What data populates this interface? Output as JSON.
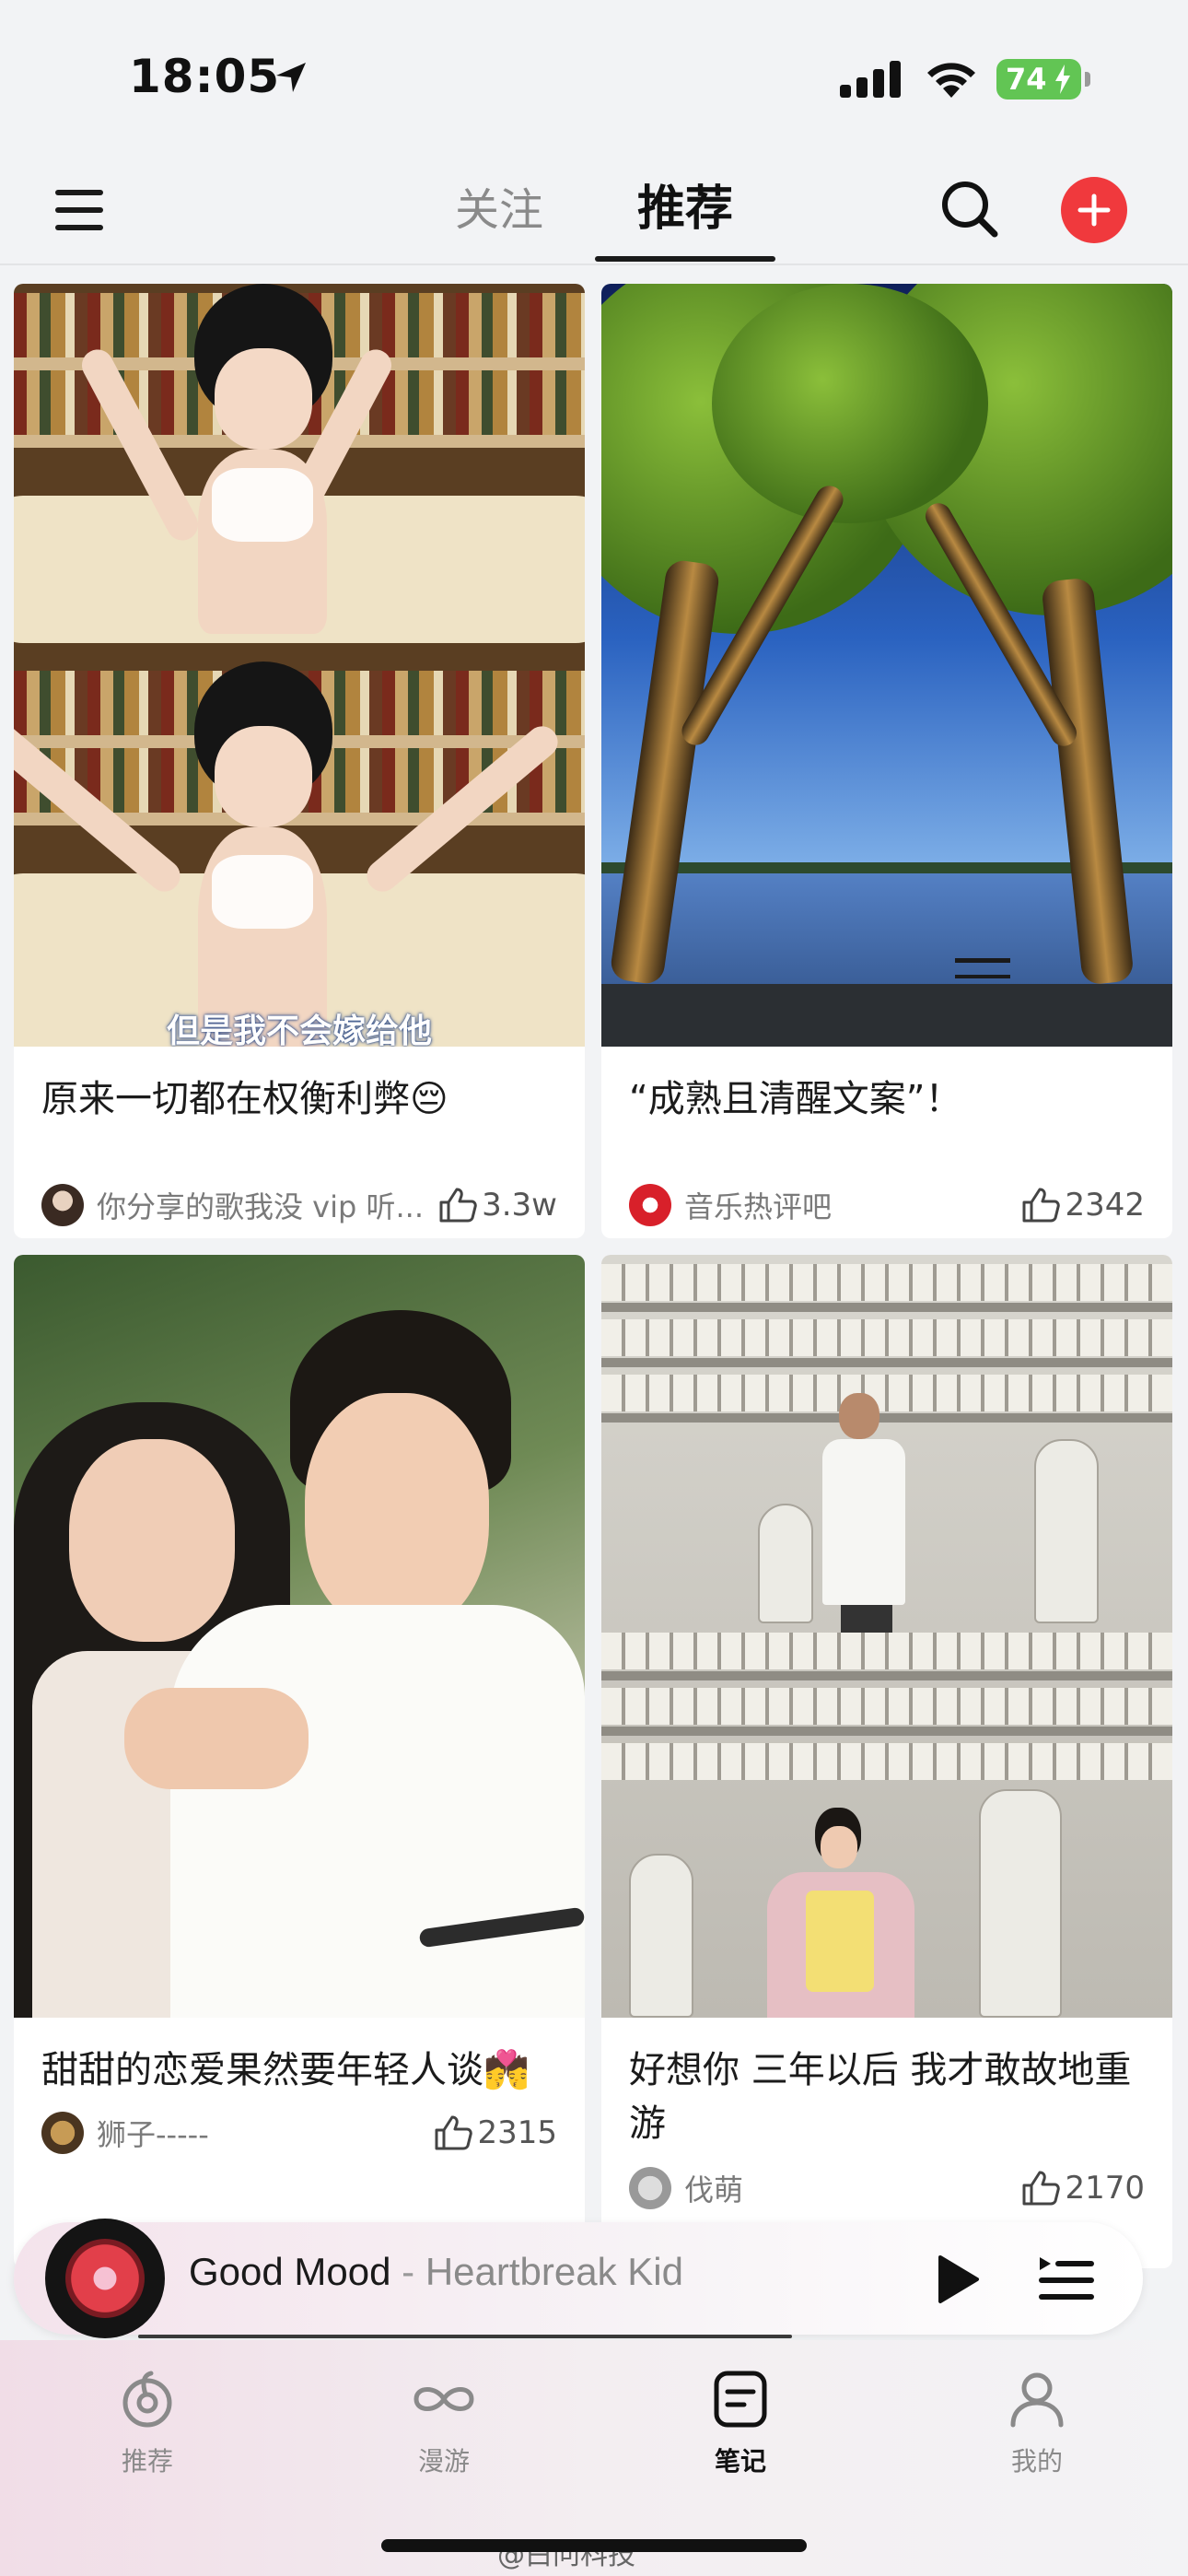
{
  "status_bar": {
    "time": "18:05",
    "battery": "74"
  },
  "top_nav": {
    "tab_follow": "关注",
    "tab_recommend": "推荐"
  },
  "feed": {
    "cards": [
      {
        "title": "原来一切都在权衡利弊😔",
        "author": "你分享的歌我没 vip 听...",
        "likes": "3.3w",
        "cover_caption": "但是我不会嫁给他"
      },
      {
        "title": "“成熟且清醒文案”！",
        "author": "音乐热评吧",
        "likes": "2342"
      },
      {
        "title": "甜甜的恋爱果然要年轻人谈💏",
        "author": "狮子-----",
        "likes": "2315"
      },
      {
        "title": "好想你 三年以后 我才敢故地重游",
        "author": "伐萌",
        "likes": "2170"
      }
    ]
  },
  "player": {
    "song": "Good Mood",
    "separator": " - ",
    "artist": "Heartbreak Kid"
  },
  "tab_bar": {
    "items": [
      {
        "label": "推荐",
        "icon": "netease-music-icon",
        "active": false
      },
      {
        "label": "漫游",
        "icon": "infinity-icon",
        "active": false
      },
      {
        "label": "笔记",
        "icon": "note-icon",
        "active": true
      },
      {
        "label": "我的",
        "icon": "person-icon",
        "active": false
      }
    ]
  },
  "watermark": "@白问科技",
  "colors": {
    "accent_red": "#f0393d",
    "battery_green": "#62c554"
  }
}
